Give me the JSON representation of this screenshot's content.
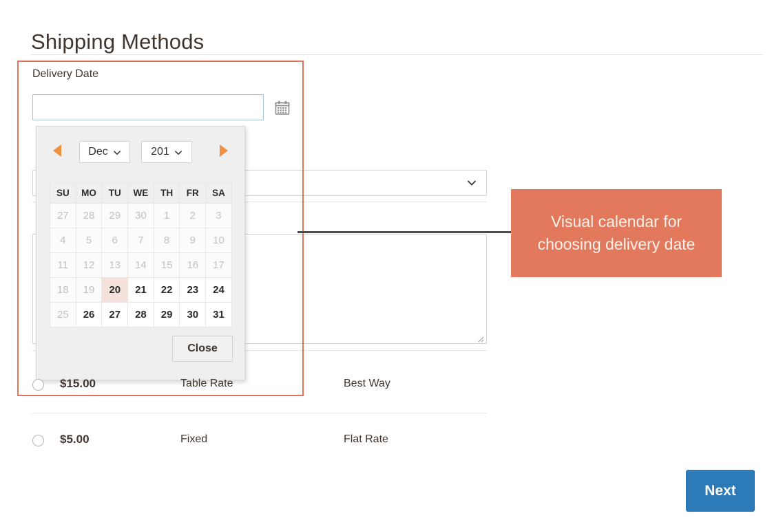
{
  "page": {
    "title": "Shipping Methods"
  },
  "colors": {
    "highlight_border": "#e2725b",
    "callout_bg": "#e2795c",
    "primary_button": "#2d7ab8",
    "nav_arrow": "#ef9140",
    "today_cell": "#f4e1dc"
  },
  "delivery_date": {
    "label": "Delivery Date",
    "value": "",
    "placeholder": "",
    "trigger_icon": "calendar-icon"
  },
  "datepicker": {
    "prev_icon": "triangle-left-icon",
    "next_icon": "triangle-right-icon",
    "month": "Dec",
    "year": "201",
    "month_chevron_icon": "chevron-down-icon",
    "year_chevron_icon": "chevron-down-icon",
    "weekdays": [
      "SU",
      "MO",
      "TU",
      "WE",
      "TH",
      "FR",
      "SA"
    ],
    "weeks": [
      [
        {
          "day": "27",
          "state": "disabled"
        },
        {
          "day": "28",
          "state": "disabled"
        },
        {
          "day": "29",
          "state": "disabled"
        },
        {
          "day": "30",
          "state": "disabled"
        },
        {
          "day": "1",
          "state": "disabled"
        },
        {
          "day": "2",
          "state": "disabled"
        },
        {
          "day": "3",
          "state": "disabled"
        }
      ],
      [
        {
          "day": "4",
          "state": "disabled"
        },
        {
          "day": "5",
          "state": "disabled"
        },
        {
          "day": "6",
          "state": "disabled"
        },
        {
          "day": "7",
          "state": "disabled"
        },
        {
          "day": "8",
          "state": "disabled"
        },
        {
          "day": "9",
          "state": "disabled"
        },
        {
          "day": "10",
          "state": "disabled"
        }
      ],
      [
        {
          "day": "11",
          "state": "disabled"
        },
        {
          "day": "12",
          "state": "disabled"
        },
        {
          "day": "13",
          "state": "disabled"
        },
        {
          "day": "14",
          "state": "disabled"
        },
        {
          "day": "15",
          "state": "disabled"
        },
        {
          "day": "16",
          "state": "disabled"
        },
        {
          "day": "17",
          "state": "disabled"
        }
      ],
      [
        {
          "day": "18",
          "state": "disabled"
        },
        {
          "day": "19",
          "state": "disabled"
        },
        {
          "day": "20",
          "state": "today"
        },
        {
          "day": "21",
          "state": "enabled"
        },
        {
          "day": "22",
          "state": "enabled"
        },
        {
          "day": "23",
          "state": "enabled"
        },
        {
          "day": "24",
          "state": "enabled"
        }
      ],
      [
        {
          "day": "25",
          "state": "disabled"
        },
        {
          "day": "26",
          "state": "enabled"
        },
        {
          "day": "27",
          "state": "enabled"
        },
        {
          "day": "28",
          "state": "enabled"
        },
        {
          "day": "29",
          "state": "enabled"
        },
        {
          "day": "30",
          "state": "enabled"
        },
        {
          "day": "31",
          "state": "enabled"
        }
      ]
    ],
    "close_label": "Close"
  },
  "form": {
    "select_value": "",
    "select_chevron_icon": "chevron-down-icon",
    "textarea_value": "",
    "textarea_resize_icon": "resize-grip-icon"
  },
  "shipping_rows": [
    {
      "price": "$15.00",
      "method": "Table Rate",
      "carrier": "Best Way"
    },
    {
      "price": "$5.00",
      "method": "Fixed",
      "carrier": "Flat Rate"
    }
  ],
  "callout": {
    "line1": "Visual calendar for",
    "line2": "choosing delivery date"
  },
  "footer": {
    "next_label": "Next"
  }
}
